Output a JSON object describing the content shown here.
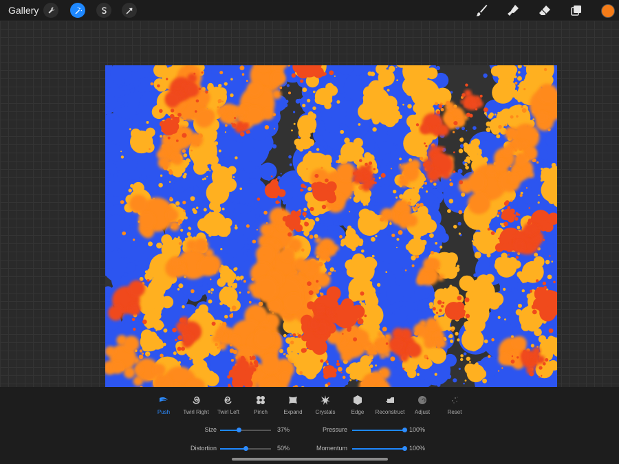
{
  "topbar": {
    "gallery_label": "Gallery",
    "left_tools": [
      {
        "name": "wrench-icon",
        "active": false
      },
      {
        "name": "magic-wand-icon",
        "active": true
      },
      {
        "name": "selection-s-icon",
        "active": false
      },
      {
        "name": "transform-arrow-icon",
        "active": false
      }
    ],
    "right_tools": [
      "brush-icon",
      "smudge-icon",
      "eraser-icon",
      "layers-icon"
    ],
    "current_color": "#f57c18"
  },
  "colors": {
    "accent": "#1e88ff",
    "canvas_dark": "#323232",
    "paint_blue": "#2c55f0",
    "paint_orange": "#ff8a1a",
    "paint_yellow": "#ffb020",
    "paint_red": "#f04a1c"
  },
  "liquify": {
    "modes": [
      {
        "label": "Push",
        "icon": "push-icon",
        "active": true
      },
      {
        "label": "Twirl Right",
        "icon": "twirl-right-icon",
        "active": false
      },
      {
        "label": "Twirl Left",
        "icon": "twirl-left-icon",
        "active": false
      },
      {
        "label": "Pinch",
        "icon": "pinch-icon",
        "active": false
      },
      {
        "label": "Expand",
        "icon": "expand-icon",
        "active": false
      },
      {
        "label": "Crystals",
        "icon": "crystals-icon",
        "active": false
      },
      {
        "label": "Edge",
        "icon": "edge-icon",
        "active": false
      },
      {
        "label": "Reconstruct",
        "icon": "reconstruct-icon",
        "active": false
      },
      {
        "label": "Adjust",
        "icon": "adjust-icon",
        "active": false
      },
      {
        "label": "Reset",
        "icon": "reset-icon",
        "active": false
      }
    ],
    "sliders": {
      "size": {
        "label": "Size",
        "value": 0.37,
        "text": "37%"
      },
      "distortion": {
        "label": "Distortion",
        "value": 0.5,
        "text": "50%"
      },
      "pressure": {
        "label": "Pressure",
        "value": 1.0,
        "text": "100%"
      },
      "momentum": {
        "label": "Momentum",
        "value": 1.0,
        "text": "100%"
      }
    }
  }
}
